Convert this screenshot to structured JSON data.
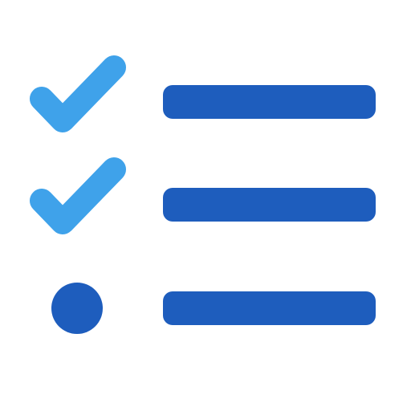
{
  "icon": {
    "name": "checklist-icon",
    "colors": {
      "check": "#3FA2EA",
      "bar": "#1E5DBD",
      "bullet": "#1E5DBD",
      "background": "#FFFFFF"
    },
    "rows": [
      {
        "marker": "check-icon",
        "state": "checked"
      },
      {
        "marker": "check-icon",
        "state": "checked"
      },
      {
        "marker": "dot-icon",
        "state": "unchecked"
      }
    ]
  }
}
